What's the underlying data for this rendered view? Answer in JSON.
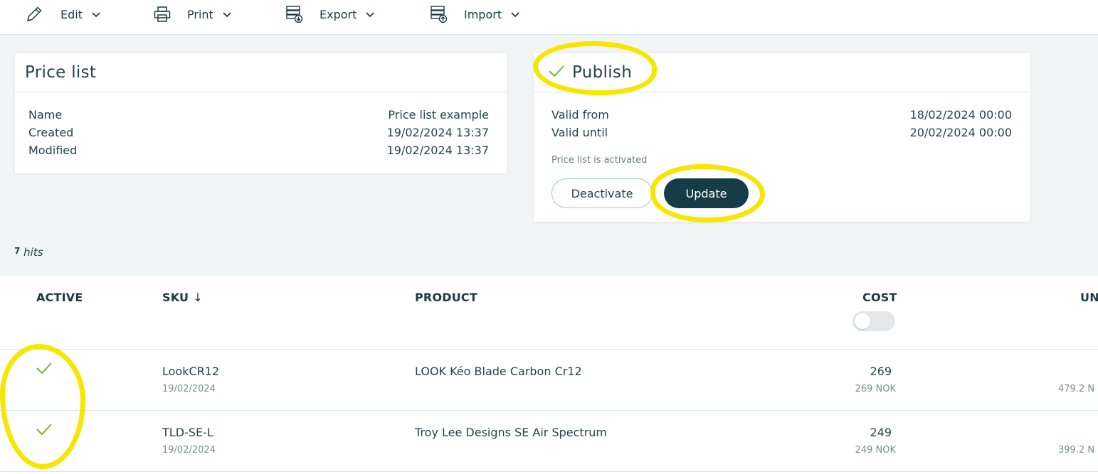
{
  "toolbar": {
    "edit": {
      "label": "Edit",
      "icon": "pencil-icon"
    },
    "print": {
      "label": "Print",
      "icon": "printer-icon"
    },
    "export": {
      "label": "Export",
      "icon": "export-icon"
    },
    "import": {
      "label": "Import",
      "icon": "import-icon"
    }
  },
  "price_list": {
    "title": "Price list",
    "rows": [
      {
        "label": "Name",
        "value": "Price list example"
      },
      {
        "label": "Created",
        "value": "19/02/2024 13:37"
      },
      {
        "label": "Modified",
        "value": "19/02/2024 13:37"
      }
    ]
  },
  "publish": {
    "title": "Publish",
    "rows": [
      {
        "label": "Valid from",
        "value": "18/02/2024 00:00"
      },
      {
        "label": "Valid until",
        "value": "20/02/2024 00:00"
      }
    ],
    "status": "Price list is activated",
    "deactivate_label": "Deactivate",
    "update_label": "Update"
  },
  "hits": {
    "count_fragment": "7",
    "label": "hits"
  },
  "table": {
    "headers": {
      "active": "ACTIVE",
      "sku": "SKU",
      "sku_sort": "↓",
      "product": "PRODUCT",
      "cost": "COST",
      "unit": "UN"
    },
    "cost_toggle_on": false,
    "rows": [
      {
        "active": true,
        "sku": "LookCR12",
        "date": "19/02/2024",
        "product": "LOOK Kéo Blade Carbon Cr12",
        "cost": "269",
        "cost_sub": "269 NOK",
        "unit_sub": "479.2 N"
      },
      {
        "active": true,
        "sku": "TLD-SE-L",
        "date": "19/02/2024",
        "product": "Troy Lee Designs SE Air Spectrum",
        "cost": "249",
        "cost_sub": "249 NOK",
        "unit_sub": "399.2 N"
      }
    ]
  },
  "colors": {
    "accent": "#163c48",
    "check": "#7ab536",
    "highlight": "#f7e600",
    "background": "#f1f5f6"
  }
}
